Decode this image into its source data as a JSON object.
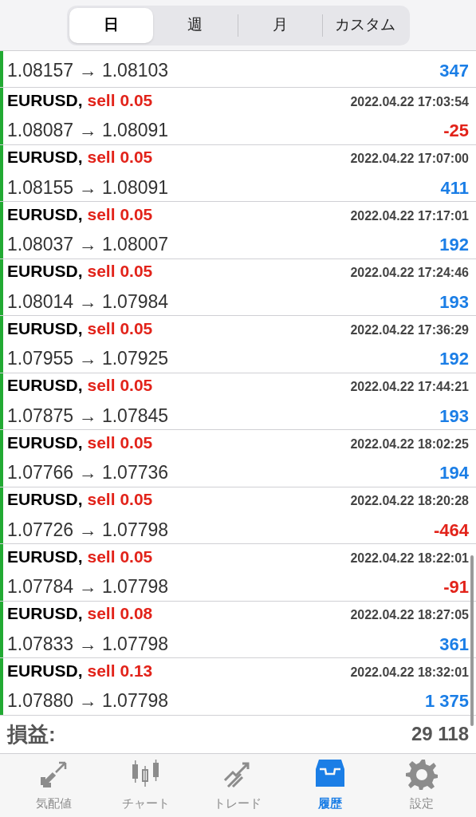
{
  "period_tabs": [
    {
      "label": "日",
      "selected": true
    },
    {
      "label": "週",
      "selected": false
    },
    {
      "label": "月",
      "selected": false
    },
    {
      "label": "カスタム",
      "selected": false
    }
  ],
  "deals": [
    {
      "prices": "1.08157 → 1.08103",
      "profit": "347",
      "loss": false
    },
    {
      "symbol": "EURUSD,",
      "trade": "sell 0.05",
      "time": "2022.04.22 17:03:54",
      "prices": "1.08087 → 1.08091",
      "profit": "-25",
      "loss": true
    },
    {
      "symbol": "EURUSD,",
      "trade": "sell 0.05",
      "time": "2022.04.22 17:07:00",
      "prices": "1.08155 → 1.08091",
      "profit": "411",
      "loss": false
    },
    {
      "symbol": "EURUSD,",
      "trade": "sell 0.05",
      "time": "2022.04.22 17:17:01",
      "prices": "1.08037 → 1.08007",
      "profit": "192",
      "loss": false
    },
    {
      "symbol": "EURUSD,",
      "trade": "sell 0.05",
      "time": "2022.04.22 17:24:46",
      "prices": "1.08014 → 1.07984",
      "profit": "193",
      "loss": false
    },
    {
      "symbol": "EURUSD,",
      "trade": "sell 0.05",
      "time": "2022.04.22 17:36:29",
      "prices": "1.07955 → 1.07925",
      "profit": "192",
      "loss": false
    },
    {
      "symbol": "EURUSD,",
      "trade": "sell 0.05",
      "time": "2022.04.22 17:44:21",
      "prices": "1.07875 → 1.07845",
      "profit": "193",
      "loss": false
    },
    {
      "symbol": "EURUSD,",
      "trade": "sell 0.05",
      "time": "2022.04.22 18:02:25",
      "prices": "1.07766 → 1.07736",
      "profit": "194",
      "loss": false
    },
    {
      "symbol": "EURUSD,",
      "trade": "sell 0.05",
      "time": "2022.04.22 18:20:28",
      "prices": "1.07726 → 1.07798",
      "profit": "-464",
      "loss": true
    },
    {
      "symbol": "EURUSD,",
      "trade": "sell 0.05",
      "time": "2022.04.22 18:22:01",
      "prices": "1.07784 → 1.07798",
      "profit": "-91",
      "loss": true
    },
    {
      "symbol": "EURUSD,",
      "trade": "sell 0.08",
      "time": "2022.04.22 18:27:05",
      "prices": "1.07833 → 1.07798",
      "profit": "361",
      "loss": false
    },
    {
      "symbol": "EURUSD,",
      "trade": "sell 0.13",
      "time": "2022.04.22 18:32:01",
      "prices": "1.07880 → 1.07798",
      "profit": "1 375",
      "loss": false
    }
  ],
  "summary": {
    "label": "損益:",
    "value": "29 118"
  },
  "bottom_tabs": [
    {
      "kind": "quotes",
      "label": "気配値",
      "selected": false
    },
    {
      "kind": "chart",
      "label": "チャート",
      "selected": false
    },
    {
      "kind": "trade",
      "label": "トレード",
      "selected": false
    },
    {
      "kind": "history",
      "label": "履歴",
      "selected": true
    },
    {
      "kind": "settings",
      "label": "設定",
      "selected": false
    }
  ]
}
